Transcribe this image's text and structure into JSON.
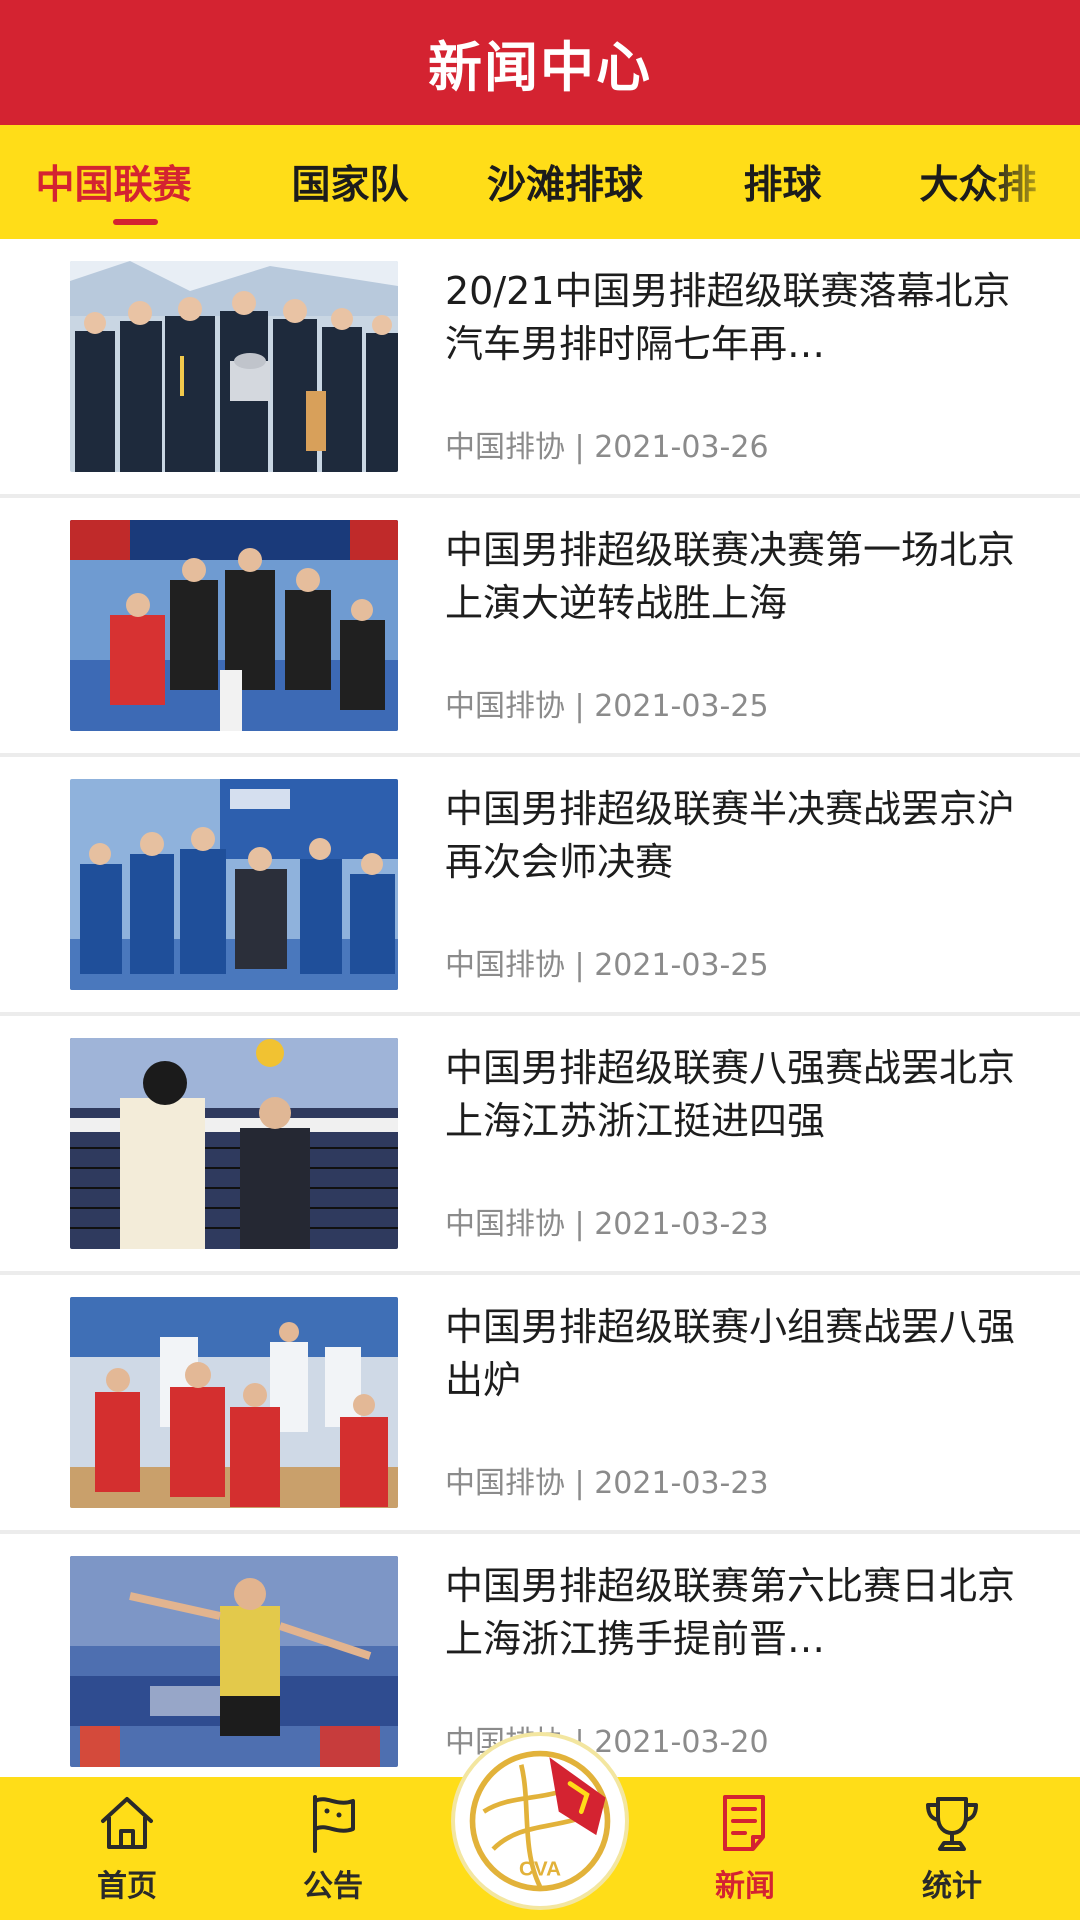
{
  "header": {
    "title": "新闻中心"
  },
  "tabs": [
    {
      "label": "中国联赛",
      "active": true
    },
    {
      "label": "国家队",
      "active": false
    },
    {
      "label": "沙滩排球",
      "active": false
    },
    {
      "label": "排球",
      "active": false
    },
    {
      "label": "大众排",
      "active": false
    }
  ],
  "news": [
    {
      "title": "20/21中国男排超级联赛落幕北京汽车男排时隔七年再…",
      "source": "中国排协",
      "date": "2021-03-26",
      "image": "trophy-ceremony-photo"
    },
    {
      "title": "中国男排超级联赛决赛第一场北京上演大逆转战胜上海",
      "source": "中国排协",
      "date": "2021-03-25",
      "image": "team-celebration-photo"
    },
    {
      "title": "中国男排超级联赛半决赛战罢京沪再次会师决赛",
      "source": "中国排协",
      "date": "2021-03-25",
      "image": "team-huddle-photo"
    },
    {
      "title": "中国男排超级联赛八强赛战罢北京上海江苏浙江挺进四强",
      "source": "中国排协",
      "date": "2021-03-23",
      "image": "net-block-photo"
    },
    {
      "title": "中国男排超级联赛小组赛战罢八强出炉",
      "source": "中国排协",
      "date": "2021-03-23",
      "image": "red-team-photo"
    },
    {
      "title": "中国男排超级联赛第六比赛日北京上海浙江携手提前晋…",
      "source": "中国排协",
      "date": "2021-03-20",
      "image": "spike-photo"
    }
  ],
  "meta_separator": " | ",
  "bottom_nav": [
    {
      "label": "首页",
      "icon": "home-icon",
      "active": false
    },
    {
      "label": "公告",
      "icon": "flag-icon",
      "active": false
    },
    {
      "label": "新闻",
      "icon": "news-doc-icon",
      "active": true
    },
    {
      "label": "统计",
      "icon": "trophy-icon",
      "active": false
    }
  ],
  "logo": {
    "text": "CVA"
  },
  "colors": {
    "primary_red": "#d42331",
    "accent_yellow": "#ffdd18",
    "text_dark": "#1d1d1d",
    "text_gray": "#8b8b8b"
  }
}
